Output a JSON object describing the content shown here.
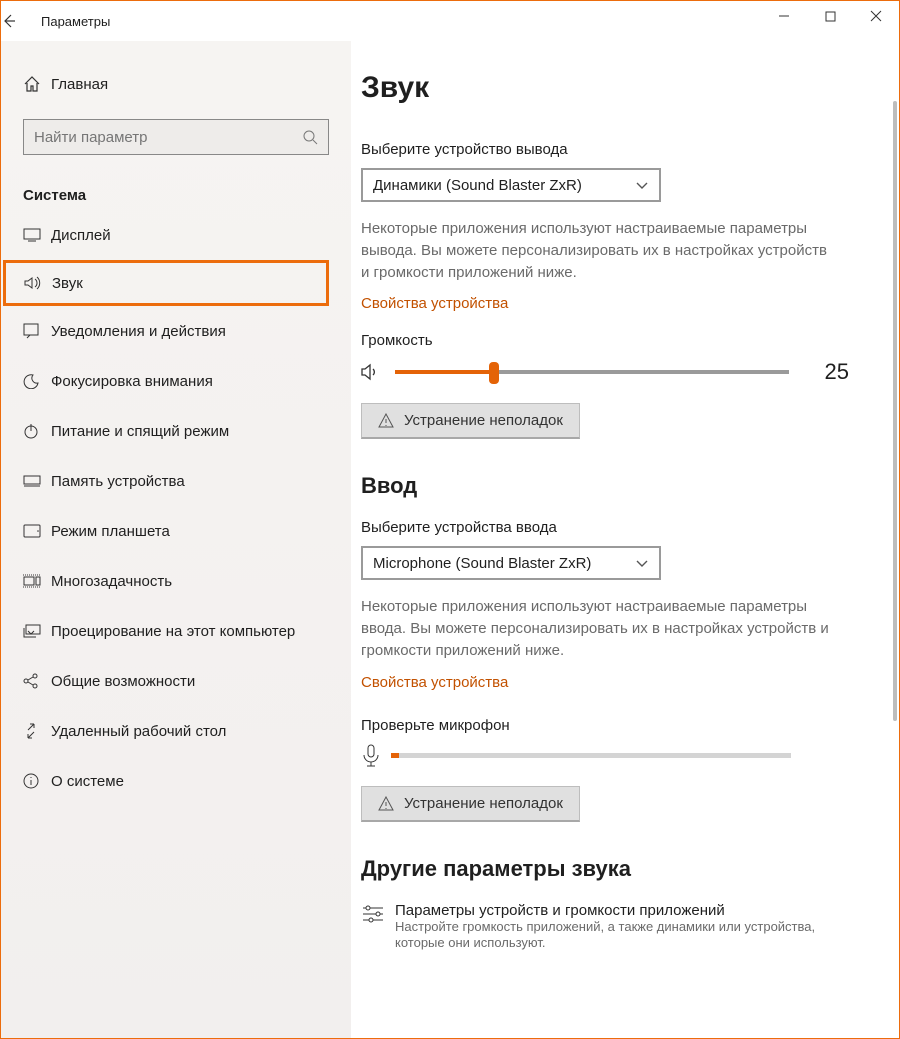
{
  "window": {
    "title": "Параметры"
  },
  "sidebar": {
    "home": "Главная",
    "search_placeholder": "Найти параметр",
    "category": "Система",
    "items": [
      "Дисплей",
      "Звук",
      "Уведомления и действия",
      "Фокусировка внимания",
      "Питание и спящий режим",
      "Память устройства",
      "Режим планшета",
      "Многозадачность",
      "Проецирование на этот компьютер",
      "Общие возможности",
      "Удаленный рабочий стол",
      "О системе"
    ],
    "selected_index": 1
  },
  "page": {
    "title": "Звук",
    "output": {
      "select_label": "Выберите устройство вывода",
      "device": "Динамики (Sound Blaster ZxR)",
      "description": "Некоторые приложения используют настраиваемые параметры вывода. Вы можете персонализировать их в настройках устройств и громкости приложений ниже.",
      "device_props": "Свойства устройства",
      "volume_label": "Громкость",
      "volume_value": "25",
      "troubleshoot": "Устранение неполадок"
    },
    "input": {
      "heading": "Ввод",
      "select_label": "Выберите устройства ввода",
      "device": "Microphone (Sound Blaster ZxR)",
      "description": "Некоторые приложения используют настраиваемые параметры ввода. Вы можете персонализировать их в настройках устройств и громкости приложений ниже.",
      "device_props": "Свойства устройства",
      "test_label": "Проверьте микрофон",
      "troubleshoot": "Устранение неполадок"
    },
    "other": {
      "heading": "Другие параметры звука",
      "opt1_title": "Параметры устройств и громкости приложений",
      "opt1_sub": "Настройте громкость приложений, а также динамики или устройства, которые они используют."
    }
  }
}
